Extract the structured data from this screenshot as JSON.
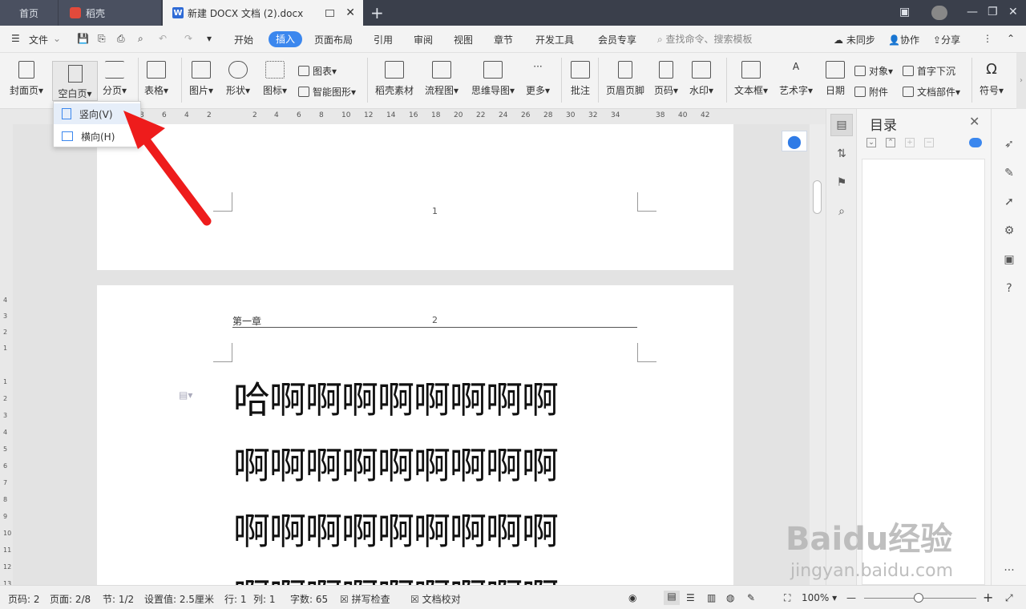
{
  "tabs": {
    "home": "首页",
    "daoke": "稻壳",
    "doc": "新建 DOCX 文档 (2).docx"
  },
  "menubar": {
    "file": "文件",
    "items": [
      "开始",
      "插入",
      "页面布局",
      "引用",
      "审阅",
      "视图",
      "章节",
      "开发工具",
      "会员专享"
    ],
    "search_placeholder": "查找命令、搜索模板",
    "sync": "未同步",
    "collab": "协作",
    "share": "分享"
  },
  "ribbon": {
    "cover": "封面页",
    "blank": "空白页",
    "break": "分页",
    "table": "表格",
    "picture": "图片",
    "shape": "形状",
    "icon": "图标",
    "chart": "图表",
    "smartart": "智能图形",
    "daoke_material": "稻壳素材",
    "flowchart": "流程图",
    "mindmap": "思维导图",
    "more": "更多",
    "comment": "批注",
    "header_footer": "页眉页脚",
    "page_number": "页码",
    "watermark": "水印",
    "textbox": "文本框",
    "wordart": "艺术字",
    "date": "日期",
    "object": "对象",
    "attachment": "附件",
    "dropcap": "首字下沉",
    "doc_parts": "文档部件",
    "symbol": "符号"
  },
  "dropdown": {
    "portrait": "竖向(V)",
    "landscape": "横向(H)"
  },
  "ruler": {
    "ticks": [
      "8",
      "6",
      "4",
      "2",
      "2",
      "4",
      "6",
      "8",
      "10",
      "12",
      "14",
      "16",
      "18",
      "20",
      "22",
      "24",
      "26",
      "28",
      "30",
      "32",
      "34",
      "38",
      "40",
      "42"
    ],
    "vticks": [
      "4",
      "3",
      "2",
      "1",
      "1",
      "2",
      "3",
      "4",
      "5",
      "6",
      "7",
      "8",
      "9",
      "10",
      "11",
      "12",
      "13"
    ]
  },
  "document": {
    "page1_number": "1",
    "page2_header": "第一章",
    "page2_number": "2",
    "lines": [
      "哈啊啊啊啊啊啊啊啊",
      "啊啊啊啊啊啊啊啊啊",
      "啊啊啊啊啊啊啊啊啊",
      "啊啊啊啊啊啊啊啊啊"
    ]
  },
  "toc": {
    "title": "目录"
  },
  "status": {
    "page_code": "页码: 2",
    "page": "页面: 2/8",
    "section": "节: 1/2",
    "setting": "设置值: 2.5厘米",
    "row": "行: 1",
    "col": "列: 1",
    "words": "字数: 65",
    "spellcheck": "拼写检查",
    "proofread": "文档校对",
    "zoom": "100%"
  },
  "watermark": {
    "brand": "Baidu经验",
    "url": "jingyan.baidu.com"
  },
  "colors": {
    "accent": "#3b87ee",
    "arrow": "#ee1c1c",
    "titlebar": "#3a3f4b"
  }
}
